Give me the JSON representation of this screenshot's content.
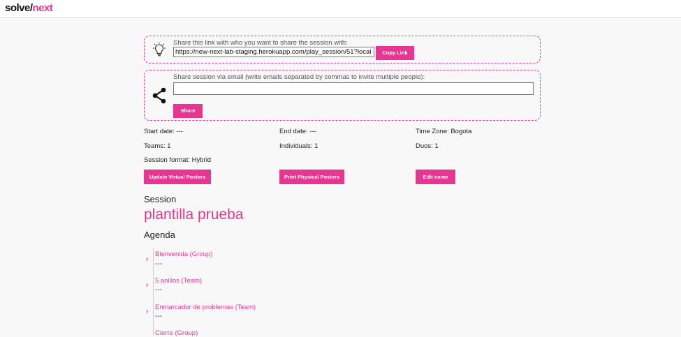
{
  "header": {
    "logo_left": "solve/",
    "logo_right": "next"
  },
  "share_link": {
    "label": "Share this link with who you want to share the session with:",
    "url": "https://new-next-lab-staging.herokuapp.com/play_session/51?local",
    "copy_label": "Copy Link",
    "icon": "lightbulb-icon"
  },
  "share_email": {
    "label": "Share session via email (write emails separated by commas to invite multiple people):",
    "value": "",
    "share_label": "Share",
    "icon": "share-icon"
  },
  "info": {
    "start_date": "Start date: ---",
    "end_date": "End date: ---",
    "time_zone": "Time Zone: Bogota",
    "teams": "Teams: 1",
    "individuals": "Individuals: 1",
    "duos": "Duos: 1",
    "session_format": "Session format: Hybrid"
  },
  "actions": {
    "update_virtual": "Update Virtual Posters",
    "print_physical": "Print Physical Posters",
    "edit_name": "Edit name"
  },
  "session": {
    "heading": "Session",
    "name": "plantilla prueba"
  },
  "agenda": {
    "heading": "Agenda",
    "items": [
      {
        "title": "Bienvenida (Group)",
        "detail": "---"
      },
      {
        "title": "5 anillos (Team)",
        "detail": "---"
      },
      {
        "title": "Enmarcador de problemas (Team)",
        "detail": "---"
      },
      {
        "title": "Cierre (Group)",
        "detail": ""
      }
    ]
  },
  "colors": {
    "accent": "#e6368f",
    "background": "#f8f8f8"
  }
}
